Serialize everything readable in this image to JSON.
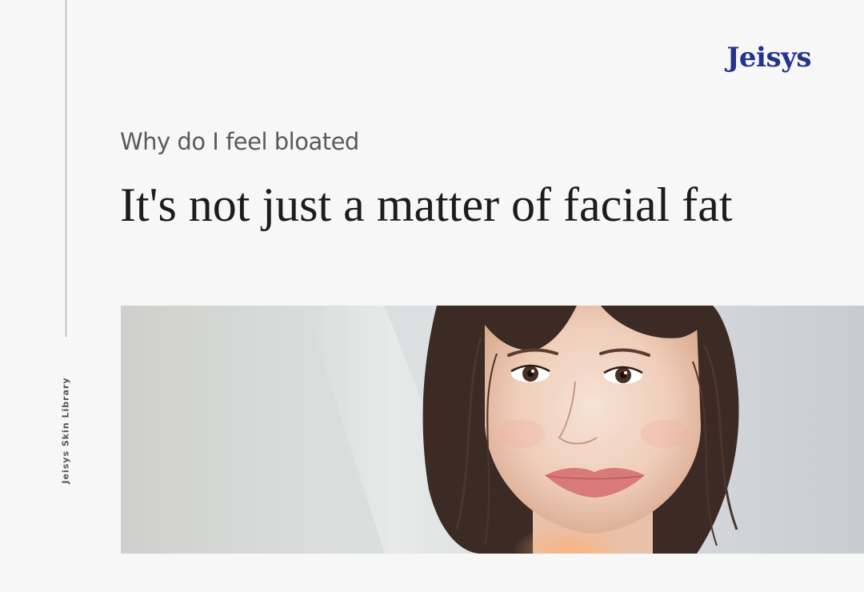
{
  "side_label": "Jeisys Skin Library",
  "brand": {
    "logo_text": "Jeisys",
    "color": "#24348c"
  },
  "header": {
    "subtitle": "Why do I feel bloated",
    "headline": "It's not just a matter of facial fat"
  },
  "hero_image": {
    "subject": "portrait-woman-face"
  }
}
